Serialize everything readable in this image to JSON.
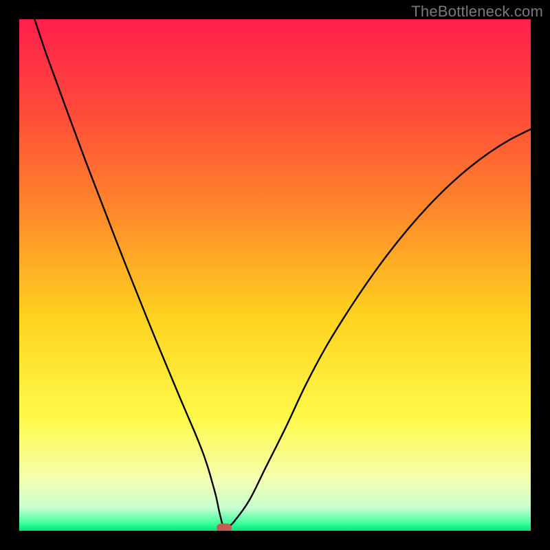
{
  "watermark": {
    "text": "TheBottleneck.com"
  },
  "chart_data": {
    "type": "line",
    "title": "",
    "xlabel": "",
    "ylabel": "",
    "xlim": [
      0,
      100
    ],
    "ylim": [
      0,
      100
    ],
    "grid": false,
    "legend": false,
    "background_gradient_stops": [
      {
        "offset": 0.0,
        "color": "#ff1f4b"
      },
      {
        "offset": 0.18,
        "color": "#ff4a3a"
      },
      {
        "offset": 0.38,
        "color": "#ff8a2a"
      },
      {
        "offset": 0.58,
        "color": "#ffd21f"
      },
      {
        "offset": 0.78,
        "color": "#fff94a"
      },
      {
        "offset": 0.9,
        "color": "#f4ffb0"
      },
      {
        "offset": 0.955,
        "color": "#c8ffd0"
      },
      {
        "offset": 0.985,
        "color": "#3fffa0"
      },
      {
        "offset": 1.0,
        "color": "#00e676"
      }
    ],
    "series": [
      {
        "name": "bottleneck-curve",
        "color": "#000000",
        "x": [
          3,
          5,
          7,
          9,
          11,
          13,
          15,
          17,
          19,
          21,
          23,
          25,
          27,
          29,
          31,
          33,
          34.5,
          36,
          37,
          37.8,
          38.5,
          39,
          39.4,
          39.7,
          39.9,
          40.5,
          42,
          45,
          48,
          52,
          56,
          60,
          64,
          68,
          72,
          76,
          80,
          84,
          88,
          92,
          96,
          100
        ],
        "y": [
          100,
          94,
          88.5,
          83,
          77.6,
          72.2,
          67,
          61.8,
          56.6,
          51.5,
          46.5,
          41.5,
          36.6,
          31.8,
          27,
          22.3,
          18.8,
          15,
          12,
          9.2,
          6.6,
          4.2,
          2.5,
          1.3,
          0.6,
          0.5,
          1.8,
          6,
          12,
          20,
          28.5,
          36,
          42.5,
          48.5,
          54,
          59,
          63.5,
          67.5,
          71,
          74,
          76.5,
          78.5
        ]
      }
    ],
    "marker": {
      "x": 40,
      "y": 0.5,
      "color": "#c75a52"
    }
  }
}
